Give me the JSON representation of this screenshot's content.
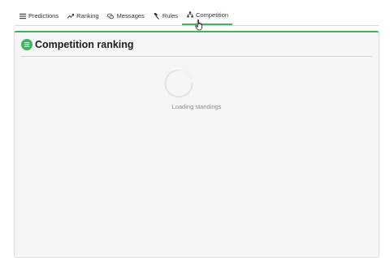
{
  "tabs": [
    {
      "label": "Predictions",
      "icon": "list-icon"
    },
    {
      "label": "Ranking",
      "icon": "trending-up-icon"
    },
    {
      "label": "Messages",
      "icon": "chat-icon"
    },
    {
      "label": "Rules",
      "icon": "gavel-icon"
    },
    {
      "label": "Competition",
      "icon": "sitemap-icon",
      "active": true
    }
  ],
  "panel": {
    "title": "Competition ranking",
    "loading_text": "Loading standings"
  },
  "colors": {
    "accent": "#3cb561",
    "panel_bg": "#f6f6f6",
    "border": "#dddddd"
  }
}
